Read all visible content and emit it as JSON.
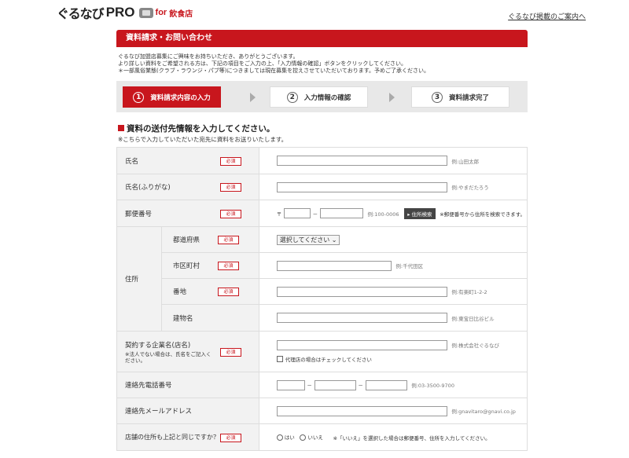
{
  "header": {
    "logo_main": "ぐるなび",
    "logo_pro": "PRO",
    "logo_for": "for",
    "logo_sub": "飲食店",
    "top_link": "ぐるなび掲載のご案内へ"
  },
  "page_title": "資料請求・お問い合わせ",
  "intro": [
    "ぐるなび加盟店募集にご興味をお持ちいただき、ありがとうございます。",
    "より詳しい資料をご希望される方は、下記の項目をご入力の上、「入力情報の確認」ボタンをクリックしてください。",
    "＊一部風俗業態(クラブ・ラウンジ・パブ等)につきましては現在募集を控えさせていただいております。予めご了承ください。"
  ],
  "steps": [
    {
      "num": "1",
      "label": "資料請求内容の入力"
    },
    {
      "num": "2",
      "label": "入力情報の確認"
    },
    {
      "num": "3",
      "label": "資料請求完了"
    }
  ],
  "section_title": "資料の送付先情報を入力してください。",
  "section_note": "※こちらで入力していただいた宛先に資料をお送りいたします。",
  "required": "必須",
  "form": {
    "name": {
      "label": "氏名",
      "example": "例:山田太郎"
    },
    "kana": {
      "label": "氏名(ふりがな)",
      "example": "例:やまだたろう"
    },
    "postal": {
      "label": "郵便番号",
      "prefix": "〒",
      "dash": "－",
      "example": "例:100-0006",
      "button": "住所検索",
      "note": "※郵便番号から住所を検索できます。"
    },
    "address": {
      "label": "住所",
      "pref": {
        "label": "都道府県",
        "select": "選択してください"
      },
      "city": {
        "label": "市区町村",
        "example": "例:千代田区"
      },
      "street": {
        "label": "番地",
        "example": "例:有楽町1-2-2"
      },
      "building": {
        "label": "建物名",
        "example": "例:東宝日比谷ビル"
      }
    },
    "company": {
      "label": "契約する企業名(店名)",
      "sublabel": "※法人でない場合は、氏名をご記入ください。",
      "example": "例:株式会社ぐるなび",
      "checkbox": "代理店の場合はチェックしてください"
    },
    "phone": {
      "label": "連絡先電話番号",
      "dash": "－",
      "example": "例:03-3500-9700"
    },
    "email": {
      "label": "連絡先メールアドレス",
      "example": "例:gnavitaro@gnavi.co.jp"
    },
    "same": {
      "label": "店舗の住所も上記と同じですか？",
      "yes": "はい",
      "no": "いいえ",
      "note": "※「いいえ」を選択した場合は郵便番号、住所を入力してください。"
    }
  }
}
